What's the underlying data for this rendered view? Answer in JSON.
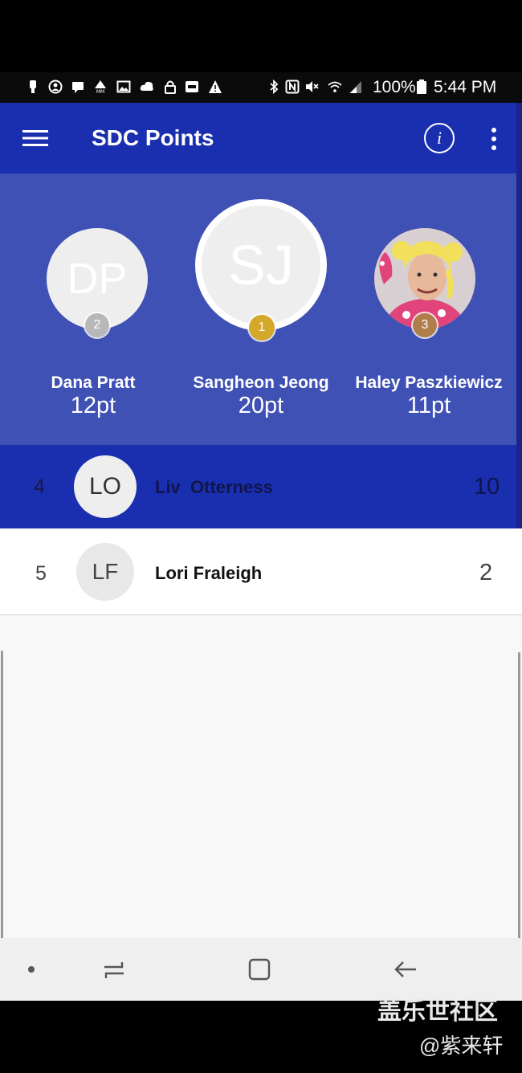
{
  "status_bar": {
    "battery": "100%",
    "time": "5:44 PM",
    "left_icons": [
      "notification-icon",
      "account-icon",
      "message-icon",
      "mm-icon",
      "image-icon",
      "cloud-icon",
      "lock-icon",
      "cast-icon",
      "warning-icon"
    ],
    "right_icons": [
      "bluetooth-icon",
      "nfc-icon",
      "mute-icon",
      "wifi-icon",
      "signal-icon",
      "battery-icon"
    ]
  },
  "app_bar": {
    "title": "SDC Points",
    "menu_icon": "menu-icon",
    "info_icon": "info-icon",
    "info_glyph": "i",
    "overflow_icon": "more-vert-icon"
  },
  "podium": [
    {
      "rank": "2",
      "initials": "DP",
      "name": "Dana Pratt",
      "points": "12pt",
      "badge_color": "#b8b8b8"
    },
    {
      "rank": "1",
      "initials": "SJ",
      "name": "Sangheon Jeong",
      "points": "20pt",
      "badge_color": "#d4a82a"
    },
    {
      "rank": "3",
      "initials": "",
      "name": "Haley Paszkiewicz",
      "points": "11pt",
      "badge_color": "#b07e4a",
      "photo": true
    }
  ],
  "list": [
    {
      "rank": "4",
      "initials": "LO",
      "name": "Liv  Otterness",
      "score": "10",
      "highlighted": true
    },
    {
      "rank": "5",
      "initials": "LF",
      "name": "Lori Fraleigh",
      "score": "2",
      "highlighted": false
    }
  ],
  "nav_bar": {
    "icons": [
      "dot-icon",
      "recents-icon",
      "home-icon",
      "back-icon"
    ]
  },
  "watermark": {
    "line1": "盖乐世社区",
    "line2": "@紫来轩"
  },
  "colors": {
    "app_bar": "#1a2eb0",
    "podium_bg": "#3f51b5",
    "gold": "#d4a82a",
    "silver": "#b8b8b8",
    "bronze": "#b07e4a"
  }
}
